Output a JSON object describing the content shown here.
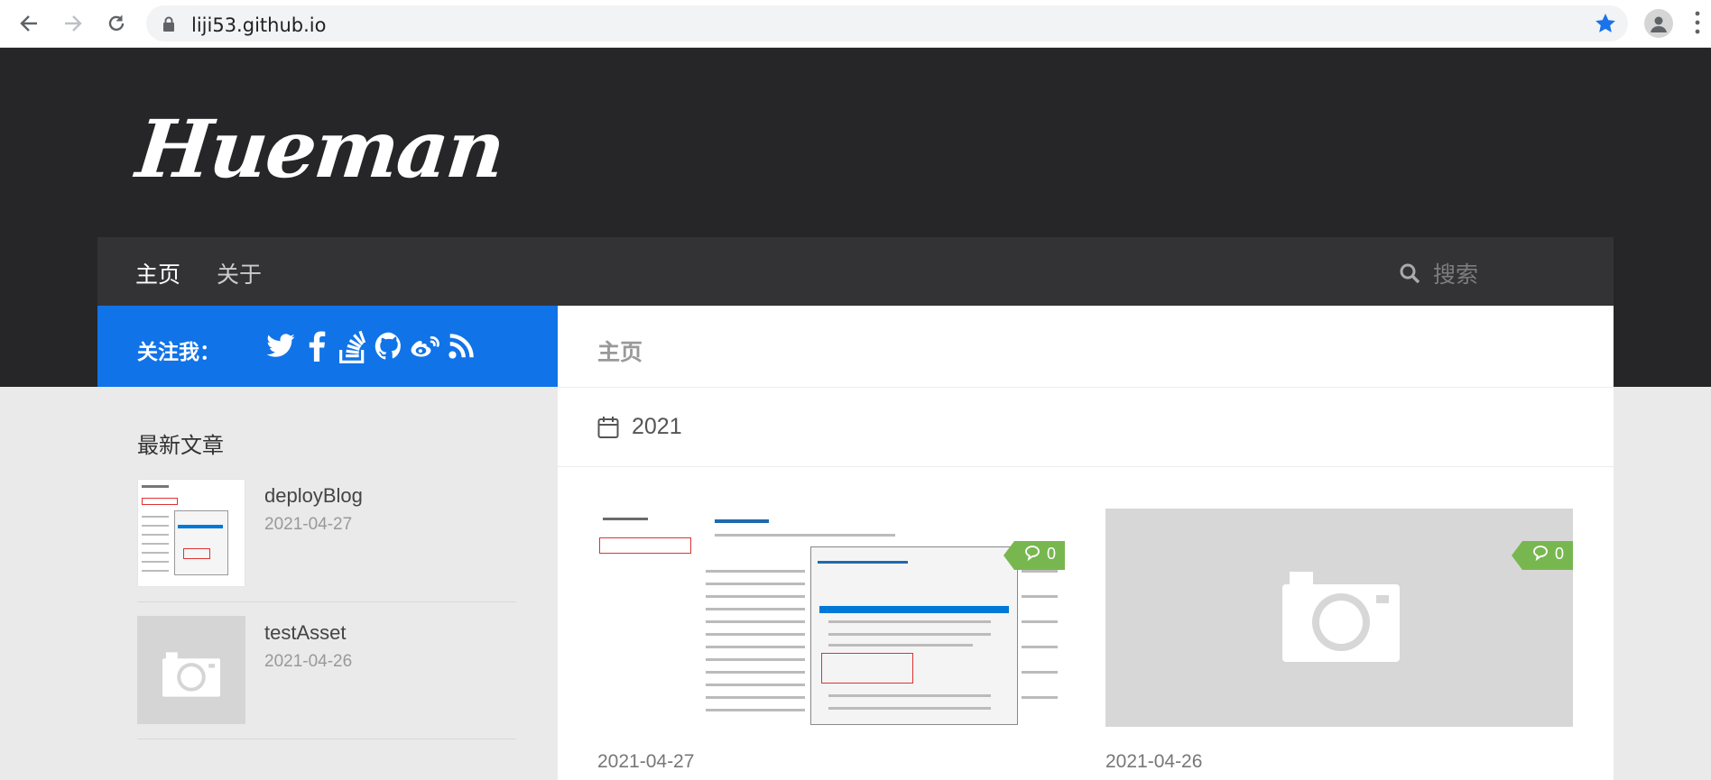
{
  "browser": {
    "url": "liji53.github.io"
  },
  "site": {
    "logo": "Hueman",
    "nav": [
      "主页",
      "关于"
    ],
    "search_placeholder": "搜索",
    "follow_label": "关注我：",
    "social_icons": [
      "twitter-icon",
      "facebook-icon",
      "stackoverflow-icon",
      "github-icon",
      "weibo-icon",
      "rss-icon"
    ]
  },
  "main": {
    "title": "主页",
    "archive_year": "2021",
    "cards": [
      {
        "date": "2021-04-27",
        "comments": "0",
        "has_image": true
      },
      {
        "date": "2021-04-26",
        "comments": "0",
        "has_image": false
      }
    ]
  },
  "sidebar": {
    "heading": "最新文章",
    "posts": [
      {
        "title": "deployBlog",
        "date": "2021-04-27"
      },
      {
        "title": "testAsset",
        "date": "2021-04-26"
      }
    ]
  },
  "colors": {
    "header_bg": "#262628",
    "nav_bg": "#333335",
    "follow_bg": "#1173e8",
    "comment_badge": "#78b74f"
  }
}
